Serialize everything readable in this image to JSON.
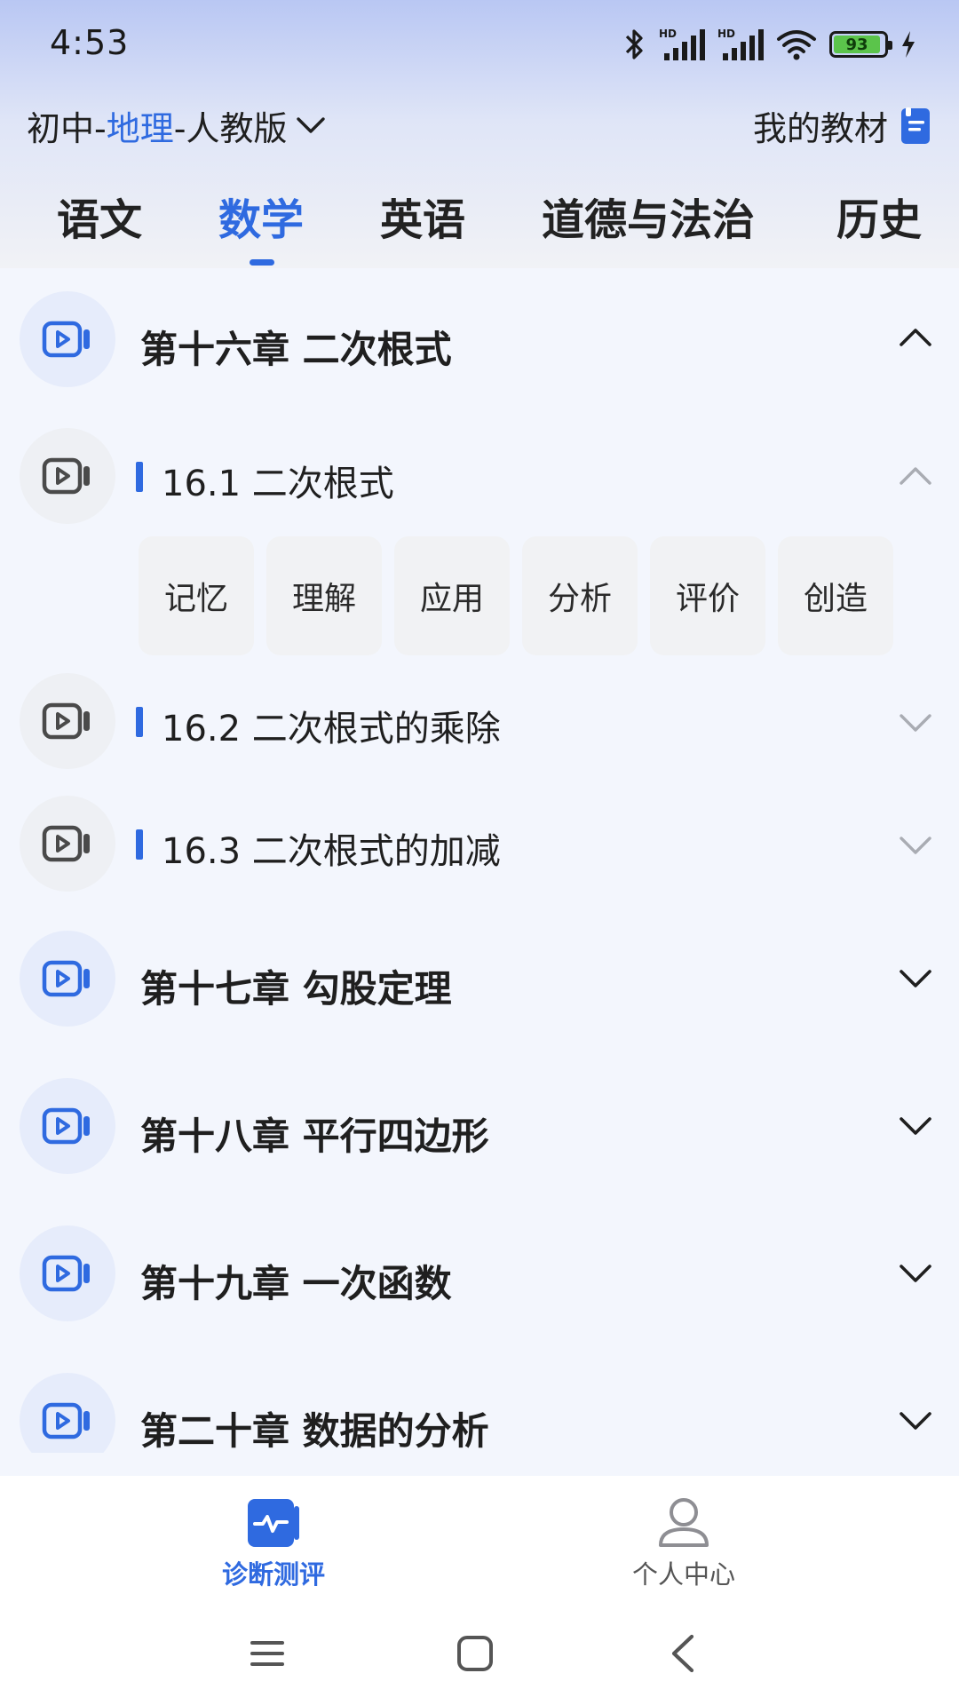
{
  "status_bar": {
    "time": "4:53",
    "battery": "93"
  },
  "header": {
    "selector": {
      "prefix": "初中-",
      "subject": "地理",
      "suffix": "-人教版"
    },
    "my_textbook_label": "我的教材"
  },
  "subject_tabs": [
    {
      "label": "语文",
      "active": false
    },
    {
      "label": "数学",
      "active": true
    },
    {
      "label": "英语",
      "active": false
    },
    {
      "label": "道德与法治",
      "active": false
    },
    {
      "label": "历史",
      "active": false
    }
  ],
  "chapters": [
    {
      "title": "第十六章 二次根式",
      "expanded": true
    },
    {
      "title": "第十七章 勾股定理",
      "expanded": false
    },
    {
      "title": "第十八章 平行四边形",
      "expanded": false
    },
    {
      "title": "第十九章 一次函数",
      "expanded": false
    },
    {
      "title": "第二十章 数据的分析",
      "expanded": false
    }
  ],
  "sections": [
    {
      "title": "16.1 二次根式",
      "expanded": true
    },
    {
      "title": "16.2 二次根式的乘除",
      "expanded": false
    },
    {
      "title": "16.3 二次根式的加减",
      "expanded": false
    }
  ],
  "cognitive_levels": [
    "记忆",
    "理解",
    "应用",
    "分析",
    "评价",
    "创造"
  ],
  "bottom_nav": [
    {
      "label": "诊断测评",
      "active": true,
      "icon": "diagnosis-icon"
    },
    {
      "label": "个人中心",
      "active": false,
      "icon": "person-icon"
    }
  ],
  "colors": {
    "accent": "#2f6ae0",
    "text": "#1f1f1f",
    "background": "#f3f6fd"
  }
}
